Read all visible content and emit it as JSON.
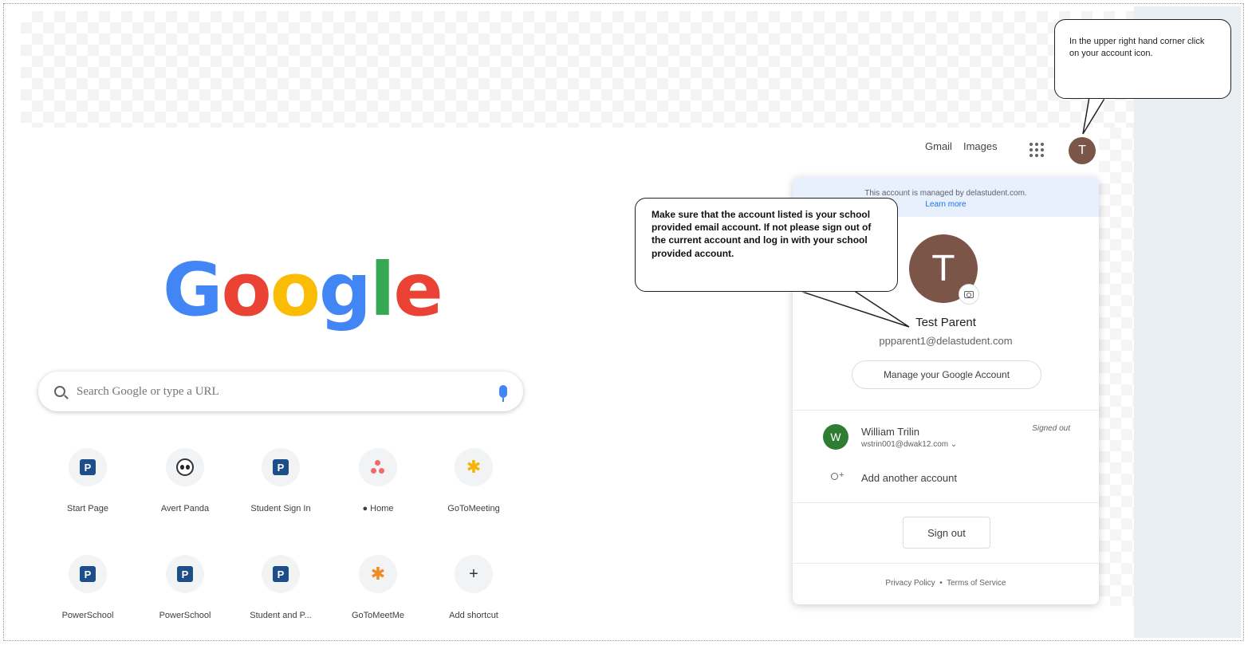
{
  "topbar": {
    "gmail": "Gmail",
    "images": "Images",
    "avatar_letter": "T"
  },
  "search": {
    "placeholder": "Search Google or type a URL"
  },
  "logo": {
    "letters": [
      "G",
      "o",
      "o",
      "g",
      "l",
      "e"
    ]
  },
  "shortcuts": [
    {
      "label": "Start Page",
      "icon": "powerschool-icon"
    },
    {
      "label": "Avert Panda",
      "icon": "panda-icon"
    },
    {
      "label": "Student Sign In",
      "icon": "powerschool-icon"
    },
    {
      "label": "● Home",
      "icon": "asana-icon"
    },
    {
      "label": "GoToMeeting",
      "icon": "gotomeeting-icon"
    },
    {
      "label": "PowerSchool",
      "icon": "powerschool-icon"
    },
    {
      "label": "PowerSchool",
      "icon": "powerschool-icon"
    },
    {
      "label": "Student and P...",
      "icon": "powerschool-icon"
    },
    {
      "label": "GoToMeetMe",
      "icon": "gotomeeting-icon"
    },
    {
      "label": "Add shortcut",
      "icon": "plus-icon"
    }
  ],
  "icon_letters": {
    "powerschool": "P",
    "plus": "+",
    "star": "✱"
  },
  "account_panel": {
    "managed_text": "This account is managed by delastudent.com.",
    "learn_more": "Learn more",
    "avatar_letter": "T",
    "name": "Test Parent",
    "email": "ppparent1@delastudent.com",
    "manage_button": "Manage your Google Account",
    "other_account": {
      "avatar_letter": "W",
      "name": "William Trilin",
      "email": "wstrin001@dwak12.com ⌄",
      "status": "Signed out"
    },
    "add_account": "Add another account",
    "sign_out": "Sign out",
    "footer": {
      "privacy": "Privacy Policy",
      "separator": "•",
      "terms": "Terms of Service"
    }
  },
  "callouts": {
    "top": "In the upper right hand corner click on your account icon.",
    "middle": "Make sure that the account listed is your school provided email account. If not please sign out of the current account and log in with your school provided account."
  },
  "colors": {
    "avatar": "#7a5548",
    "google_blue": "#4285f4",
    "google_red": "#ea4335",
    "google_yellow": "#fbbc05",
    "google_green": "#34a853",
    "banner": "#e8f0fe",
    "other_avatar": "#2e7d32"
  }
}
